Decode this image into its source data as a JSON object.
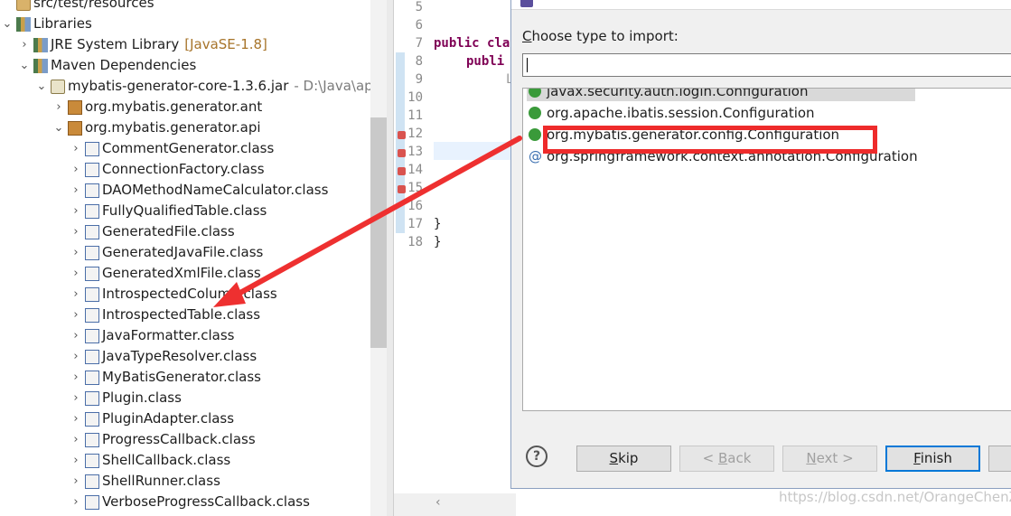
{
  "tree": {
    "items": [
      {
        "label": "src/test/resources",
        "icon": "folder-package-icon",
        "chev": ""
      },
      {
        "label": "Libraries",
        "icon": "libraries-icon",
        "chev": "v"
      },
      {
        "label": "JRE System Library",
        "extra": "[JavaSE-1.8]",
        "icon": "jre-library-icon",
        "chev": ">"
      },
      {
        "label": "Maven Dependencies",
        "icon": "maven-library-icon",
        "chev": "v"
      },
      {
        "label": "mybatis-generator-core-1.3.6.jar",
        "extra": "- D:\\Java\\apa",
        "icon": "jar-icon",
        "chev": "v"
      },
      {
        "label": "org.mybatis.generator.ant",
        "icon": "package-icon",
        "chev": ">"
      },
      {
        "label": "org.mybatis.generator.api",
        "icon": "package-icon",
        "chev": "v"
      },
      {
        "label": "CommentGenerator.class",
        "icon": "class-file-icon",
        "chev": ">"
      },
      {
        "label": "ConnectionFactory.class",
        "icon": "class-file-icon",
        "chev": ">"
      },
      {
        "label": "DAOMethodNameCalculator.class",
        "icon": "class-file-icon",
        "chev": ">"
      },
      {
        "label": "FullyQualifiedTable.class",
        "icon": "class-file-icon",
        "chev": ">"
      },
      {
        "label": "GeneratedFile.class",
        "icon": "abstract-class-file-icon",
        "chev": ">"
      },
      {
        "label": "GeneratedJavaFile.class",
        "icon": "class-file-icon",
        "chev": ">"
      },
      {
        "label": "GeneratedXmlFile.class",
        "icon": "class-file-icon",
        "chev": ">"
      },
      {
        "label": "IntrospectedColumn.class",
        "icon": "class-file-icon",
        "chev": ">"
      },
      {
        "label": "IntrospectedTable.class",
        "icon": "abstract-class-file-icon",
        "chev": ">"
      },
      {
        "label": "JavaFormatter.class",
        "icon": "class-file-icon",
        "chev": ">"
      },
      {
        "label": "JavaTypeResolver.class",
        "icon": "class-file-icon",
        "chev": ">"
      },
      {
        "label": "MyBatisGenerator.class",
        "icon": "class-file-icon",
        "chev": ">"
      },
      {
        "label": "Plugin.class",
        "icon": "class-file-icon",
        "chev": ">"
      },
      {
        "label": "PluginAdapter.class",
        "icon": "abstract-class-file-icon",
        "chev": ">"
      },
      {
        "label": "ProgressCallback.class",
        "icon": "class-file-icon",
        "chev": ">"
      },
      {
        "label": "ShellCallback.class",
        "icon": "class-file-icon",
        "chev": ">"
      },
      {
        "label": "ShellRunner.class",
        "icon": "class-file-icon",
        "chev": ">"
      },
      {
        "label": "VerboseProgressCallback.class",
        "icon": "class-file-icon",
        "chev": ">"
      }
    ]
  },
  "editor": {
    "line_numbers": [
      "5",
      "6",
      "7",
      "8",
      "9",
      "10",
      "11",
      "12",
      "13",
      "14",
      "15",
      "16",
      "17",
      "18"
    ],
    "code": {
      "l7": "public cla",
      "l8": "publi",
      "l9": "L",
      "l17": "}",
      "l18": "}"
    }
  },
  "dialog": {
    "prompt": "Choose type to import:",
    "search_value": "",
    "results": [
      {
        "text": "javax.security.auth.login.Configuration",
        "icon": "class-icon",
        "selected": true
      },
      {
        "text": "org.apache.ibatis.session.Configuration",
        "icon": "class-icon",
        "selected": false
      },
      {
        "text": "org.mybatis.generator.config.Configuration",
        "icon": "class-icon",
        "selected": false
      },
      {
        "text": "org.springframework.context.annotation.Configuration",
        "icon": "annotation-icon",
        "selected": false
      }
    ],
    "buttons": {
      "help": "?",
      "skip": "Skip",
      "back": "< Back",
      "next": "Next >",
      "finish": "Finish"
    }
  },
  "colors": {
    "highlight": "#ee2b2b",
    "class_icon": "#3a9a3a",
    "keyword": "#7f0055"
  },
  "watermark": "https://blog.csdn.net/OrangeChenZ"
}
